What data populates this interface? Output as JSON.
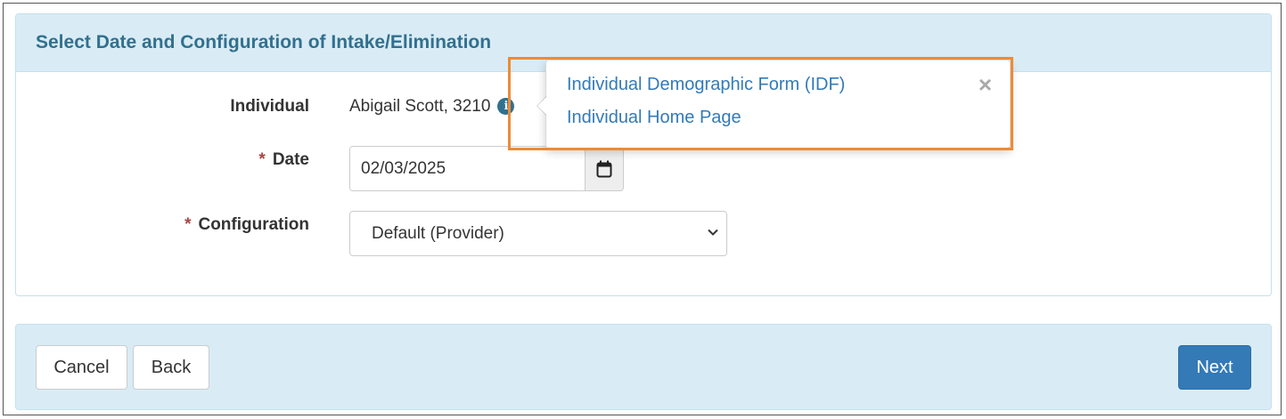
{
  "panel": {
    "title": "Select Date and Configuration of Intake/Elimination"
  },
  "form": {
    "individual": {
      "label": "Individual",
      "value": "Abigail Scott, 3210",
      "info_icon": "info-circle-icon"
    },
    "date": {
      "required_marker": "*",
      "label": "Date",
      "value": "02/03/2025",
      "calendar_icon": "calendar-icon"
    },
    "configuration": {
      "required_marker": "*",
      "label": "Configuration",
      "selected": "Default (Provider)",
      "chevron_icon": "chevron-down-icon"
    }
  },
  "popover": {
    "links": [
      "Individual Demographic Form (IDF)",
      "Individual Home Page"
    ],
    "close_symbol": "×"
  },
  "footer": {
    "cancel_label": "Cancel",
    "back_label": "Back",
    "next_label": "Next"
  },
  "colors": {
    "heading_bg": "#d9ecf6",
    "heading_text": "#31708f",
    "link": "#337ab7",
    "primary_button": "#337ab7",
    "required": "#a94442",
    "highlight": "#ed8b36"
  }
}
